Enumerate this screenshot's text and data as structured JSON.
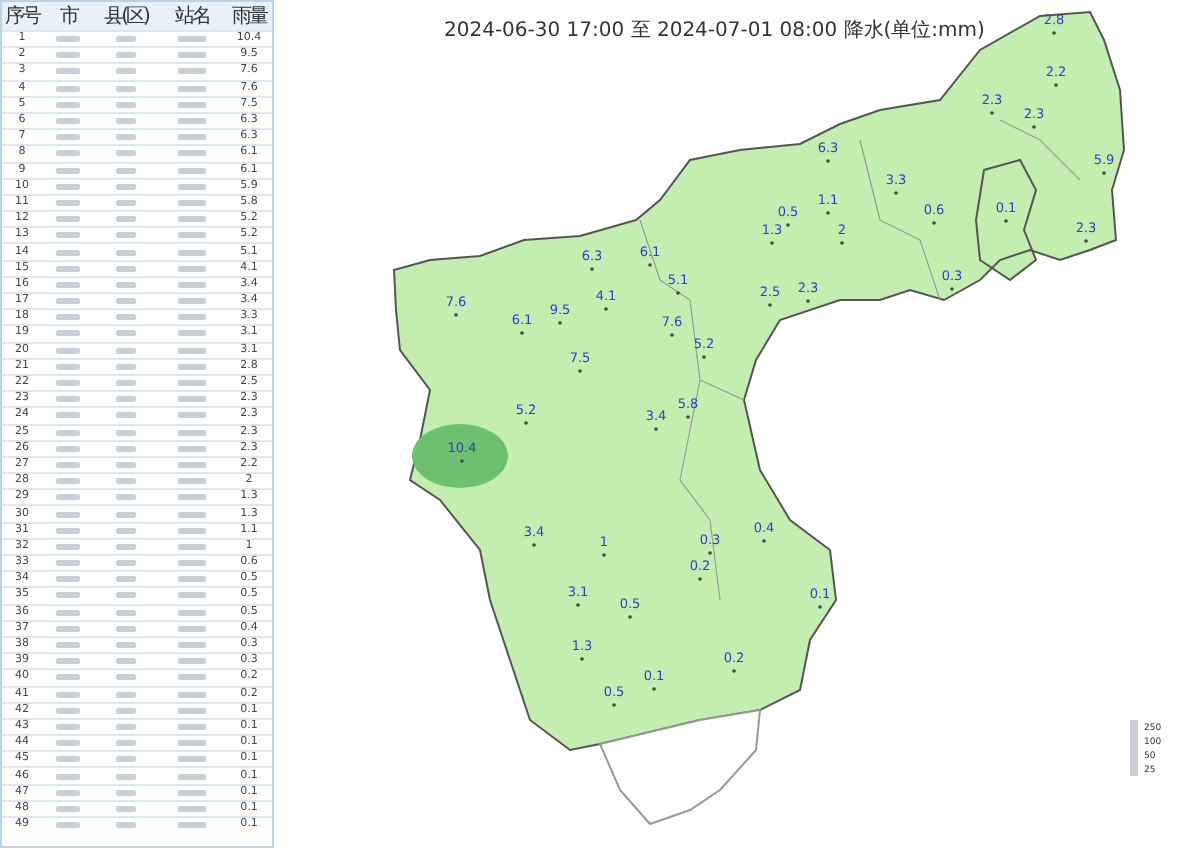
{
  "table": {
    "columns": [
      "序号",
      "市",
      "县(区)",
      "站名",
      "雨量"
    ],
    "rows": [
      {
        "no": "1",
        "rain": "10.4"
      },
      {
        "no": "2",
        "rain": "9.5"
      },
      {
        "no": "3",
        "rain": "7.6"
      },
      {
        "no": "4",
        "rain": "7.6"
      },
      {
        "no": "5",
        "rain": "7.5"
      },
      {
        "no": "6",
        "rain": "6.3"
      },
      {
        "no": "7",
        "rain": "6.3"
      },
      {
        "no": "8",
        "rain": "6.1"
      },
      {
        "no": "9",
        "rain": "6.1"
      },
      {
        "no": "10",
        "rain": "5.9"
      },
      {
        "no": "11",
        "rain": "5.8"
      },
      {
        "no": "12",
        "rain": "5.2"
      },
      {
        "no": "13",
        "rain": "5.2"
      },
      {
        "no": "14",
        "rain": "5.1"
      },
      {
        "no": "15",
        "rain": "4.1"
      },
      {
        "no": "16",
        "rain": "3.4"
      },
      {
        "no": "17",
        "rain": "3.4"
      },
      {
        "no": "18",
        "rain": "3.3"
      },
      {
        "no": "19",
        "rain": "3.1"
      },
      {
        "no": "20",
        "rain": "3.1"
      },
      {
        "no": "21",
        "rain": "2.8"
      },
      {
        "no": "22",
        "rain": "2.5"
      },
      {
        "no": "23",
        "rain": "2.3"
      },
      {
        "no": "24",
        "rain": "2.3"
      },
      {
        "no": "25",
        "rain": "2.3"
      },
      {
        "no": "26",
        "rain": "2.3"
      },
      {
        "no": "27",
        "rain": "2.2"
      },
      {
        "no": "28",
        "rain": "2"
      },
      {
        "no": "29",
        "rain": "1.3"
      },
      {
        "no": "30",
        "rain": "1.3"
      },
      {
        "no": "31",
        "rain": "1.1"
      },
      {
        "no": "32",
        "rain": "1"
      },
      {
        "no": "33",
        "rain": "0.6"
      },
      {
        "no": "34",
        "rain": "0.5"
      },
      {
        "no": "35",
        "rain": "0.5"
      },
      {
        "no": "36",
        "rain": "0.5"
      },
      {
        "no": "37",
        "rain": "0.4"
      },
      {
        "no": "38",
        "rain": "0.3"
      },
      {
        "no": "39",
        "rain": "0.3"
      },
      {
        "no": "40",
        "rain": "0.2"
      },
      {
        "no": "41",
        "rain": "0.2"
      },
      {
        "no": "42",
        "rain": "0.1"
      },
      {
        "no": "43",
        "rain": "0.1"
      },
      {
        "no": "44",
        "rain": "0.1"
      },
      {
        "no": "45",
        "rain": "0.1"
      },
      {
        "no": "46",
        "rain": "0.1"
      },
      {
        "no": "47",
        "rain": "0.1"
      },
      {
        "no": "48",
        "rain": "0.1"
      },
      {
        "no": "49",
        "rain": "0.1"
      }
    ]
  },
  "map": {
    "title": "2024-06-30 17:00 至 2024-07-01 08:00 降水(单位:mm)",
    "stations": [
      {
        "value": "2.8"
      },
      {
        "value": "2.2"
      },
      {
        "value": "2.3"
      },
      {
        "value": "2.3"
      },
      {
        "value": "5.9"
      },
      {
        "value": "2.3"
      },
      {
        "value": "6.3"
      },
      {
        "value": "3.3"
      },
      {
        "value": "0.5"
      },
      {
        "value": "1.1"
      },
      {
        "value": "1.3"
      },
      {
        "value": "2"
      },
      {
        "value": "0.6"
      },
      {
        "value": "0.1"
      },
      {
        "value": "0.3"
      },
      {
        "value": "6.1"
      },
      {
        "value": "5.1"
      },
      {
        "value": "6.3"
      },
      {
        "value": "7.6"
      },
      {
        "value": "6.1"
      },
      {
        "value": "9.5"
      },
      {
        "value": "4.1"
      },
      {
        "value": "7.5"
      },
      {
        "value": "7.6"
      },
      {
        "value": "5.2"
      },
      {
        "value": "2.5"
      },
      {
        "value": "2.3"
      },
      {
        "value": "5.2"
      },
      {
        "value": "3.4"
      },
      {
        "value": "5.8"
      },
      {
        "value": "10.4"
      },
      {
        "value": "3.4"
      },
      {
        "value": "1"
      },
      {
        "value": "0.3"
      },
      {
        "value": "0.2"
      },
      {
        "value": "0.4"
      },
      {
        "value": "3.1"
      },
      {
        "value": "0.5"
      },
      {
        "value": "0.1"
      },
      {
        "value": "1.3"
      },
      {
        "value": "0.1"
      },
      {
        "value": "0.5"
      },
      {
        "value": "0.2"
      }
    ],
    "legend": [
      "250",
      "100",
      "50",
      "25"
    ]
  }
}
